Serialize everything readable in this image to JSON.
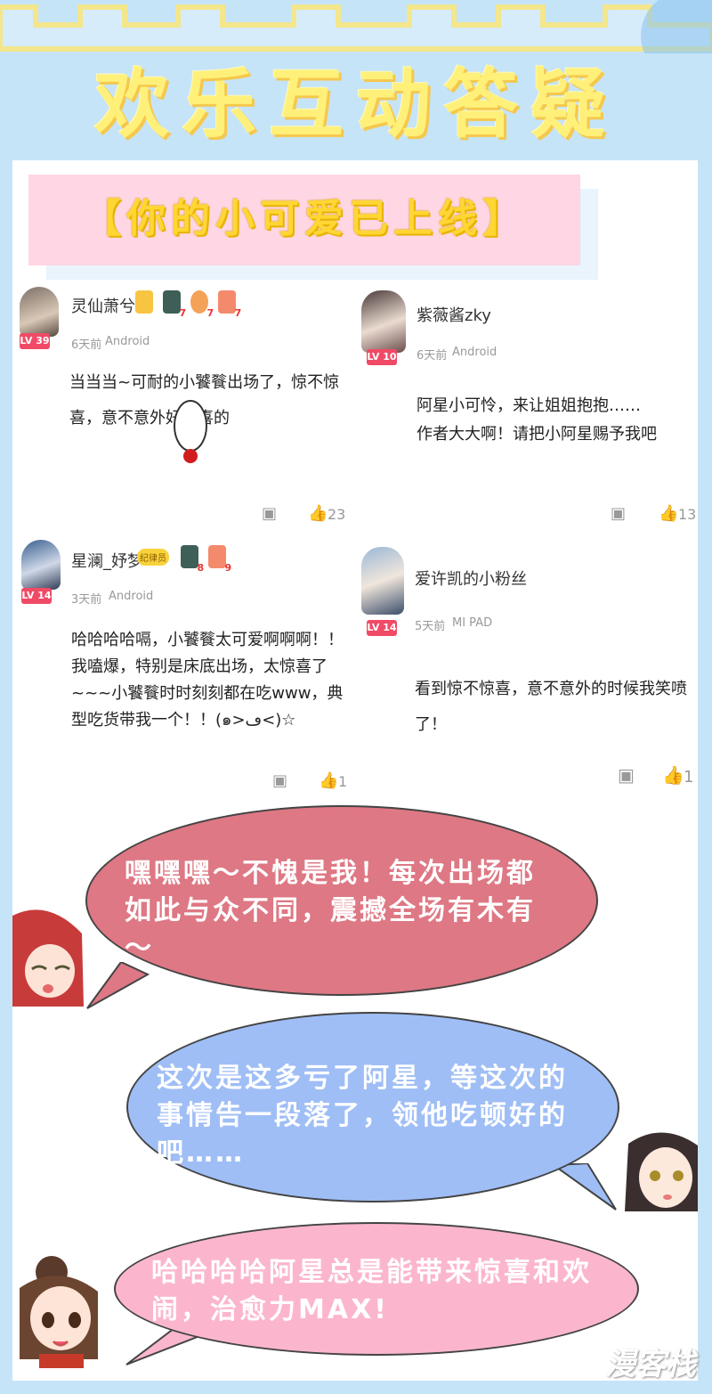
{
  "header": {
    "title": "欢乐互动答疑",
    "banner": "【你的小可爱已上线】"
  },
  "comments": [
    {
      "user": "灵仙萧兮",
      "level": "LV 39",
      "time": "6天前",
      "device": "Android",
      "text": "当当当~可耐的小饕餮出场了，惊不惊喜，意不意外好惊喜的",
      "reply_icon": "comment-icon",
      "likes": "23",
      "badge_nums": [
        "7",
        "7",
        "7"
      ]
    },
    {
      "user": "紫薇酱zky",
      "level": "LV 10",
      "time": "6天前",
      "device": "Android",
      "text": "阿星小可怜，来让姐姐抱抱……\n作者大大啊！请把小阿星赐予我吧",
      "reply_icon": "comment-icon",
      "likes": "13"
    },
    {
      "user": "星澜_妤梦",
      "level": "LV 14",
      "time": "3天前",
      "device": "Android",
      "text": "哈哈哈哈嗝，小饕餮太可爱啊啊啊！！我嗑爆，特别是床底出场，太惊喜了~~~小饕餮时时刻刻都在吃www，典型吃货带我一个！！(๑>ڡ<)☆",
      "reply_icon": "comment-icon",
      "likes": "1",
      "tag": "纪律员",
      "badge_nums": [
        "8",
        "9"
      ]
    },
    {
      "user": "爱许凯的小粉丝",
      "level": "LV 14",
      "time": "5天前",
      "device": "MI PAD",
      "text": "看到惊不惊喜，意不意外的时候我笑喷了！",
      "reply_icon": "comment-icon",
      "likes": "1"
    }
  ],
  "bubbles": [
    {
      "text": "嘿嘿嘿～不愧是我！每次出场都如此与众不同，震撼全场有木有～",
      "color": "#de7884"
    },
    {
      "text": "这次是这多亏了阿星，等这次的事情告一段落了，领他吃顿好的吧……",
      "color": "#9fbef6"
    },
    {
      "text": "哈哈哈哈阿星总是能带来惊喜和欢闹，治愈力MAX!",
      "color": "#fbb6cd"
    }
  ],
  "watermark": "漫客栈",
  "colors": {
    "background": "#c6e4f8",
    "title": "#fff07a",
    "banner": "#ffd6e3",
    "level_badge": "#f04a66"
  }
}
